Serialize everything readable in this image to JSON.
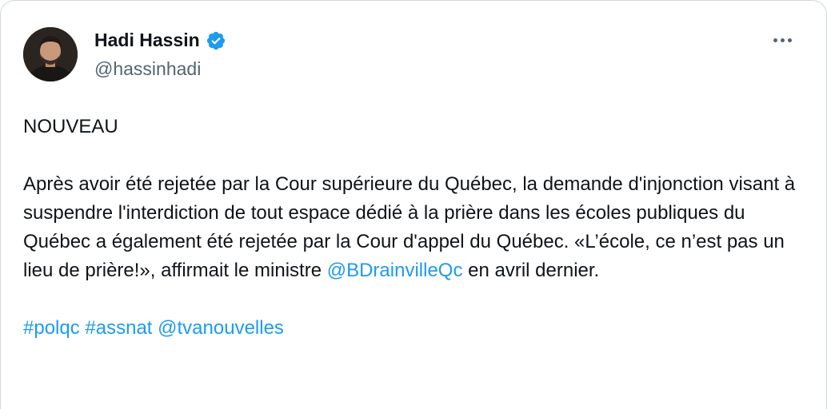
{
  "author": {
    "display_name": "Hadi Hassin",
    "handle": "@hassinhadi",
    "verified": true,
    "avatar_icon": "profile-photo"
  },
  "menu": {
    "icon": "more-horizontal-icon"
  },
  "tweet": {
    "headline": "NOUVEAU",
    "body_before_mention": "Après avoir été rejetée par la Cour supérieure du Québec, la demande d'injonction visant à suspendre l'interdiction de tout espace dédié à la prière dans les écoles publiques du Québec a également été rejetée par la Cour d'appel du Québec. «L’école, ce n’est pas un lieu de prière!», affirmait le ministre ",
    "mention": "@BDrainvilleQc",
    "body_after_mention": " en avril dernier.",
    "tags": [
      "#polqc",
      "#assnat",
      "@tvanouvelles"
    ]
  },
  "colors": {
    "link": "#1d9bf0",
    "text": "#0f1419",
    "secondary": "#536471",
    "verified_badge": "#1d9bf0"
  }
}
